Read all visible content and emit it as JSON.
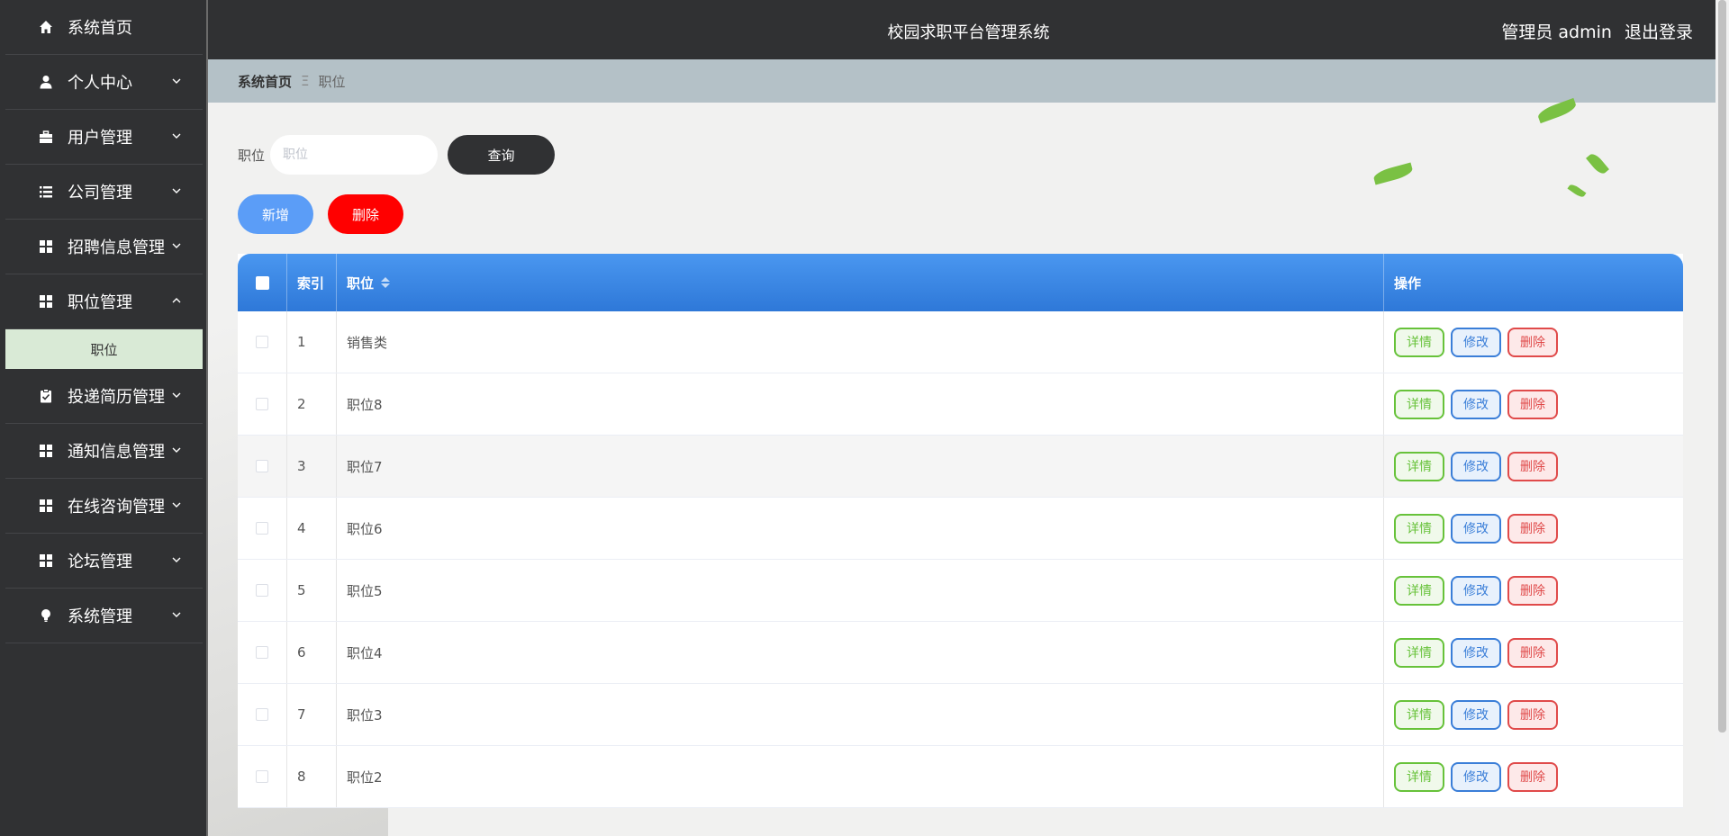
{
  "header": {
    "title": "校园求职平台管理系统",
    "user_label": "管理员 admin",
    "logout_label": "退出登录"
  },
  "sidebar": {
    "items": [
      {
        "label": "系统首页",
        "icon": "home-icon"
      },
      {
        "label": "个人中心",
        "icon": "user-icon"
      },
      {
        "label": "用户管理",
        "icon": "briefcase-icon"
      },
      {
        "label": "公司管理",
        "icon": "list-icon"
      },
      {
        "label": "招聘信息管理",
        "icon": "grid-icon"
      },
      {
        "label": "职位管理",
        "icon": "grid-icon"
      },
      {
        "label": "投递简历管理",
        "icon": "clipboard-icon"
      },
      {
        "label": "通知信息管理",
        "icon": "grid-icon"
      },
      {
        "label": "在线咨询管理",
        "icon": "grid-icon"
      },
      {
        "label": "论坛管理",
        "icon": "grid-icon"
      },
      {
        "label": "系统管理",
        "icon": "bulb-icon"
      }
    ],
    "sub_item": "职位"
  },
  "breadcrumb": {
    "home": "系统首页",
    "separator": "Ξ",
    "current": "职位"
  },
  "search": {
    "label": "职位",
    "placeholder": "职位",
    "query_button": "查询"
  },
  "actions": {
    "add": "新增",
    "delete": "删除"
  },
  "table": {
    "headers": {
      "index": "索引",
      "position": "职位",
      "ops": "操作"
    },
    "row_ops": {
      "view": "详情",
      "edit": "修改",
      "delete": "删除"
    },
    "rows": [
      {
        "index": "1",
        "position": "销售类"
      },
      {
        "index": "2",
        "position": "职位8"
      },
      {
        "index": "3",
        "position": "职位7"
      },
      {
        "index": "4",
        "position": "职位6"
      },
      {
        "index": "5",
        "position": "职位5"
      },
      {
        "index": "6",
        "position": "职位4"
      },
      {
        "index": "7",
        "position": "职位3"
      },
      {
        "index": "8",
        "position": "职位2"
      }
    ]
  },
  "colors": {
    "sidebar_bg": "#303133",
    "table_header": "#3a87e6",
    "add_button": "#5b9df7",
    "delete_button": "#ff0000",
    "active_sub_bg": "#d9ead6"
  }
}
